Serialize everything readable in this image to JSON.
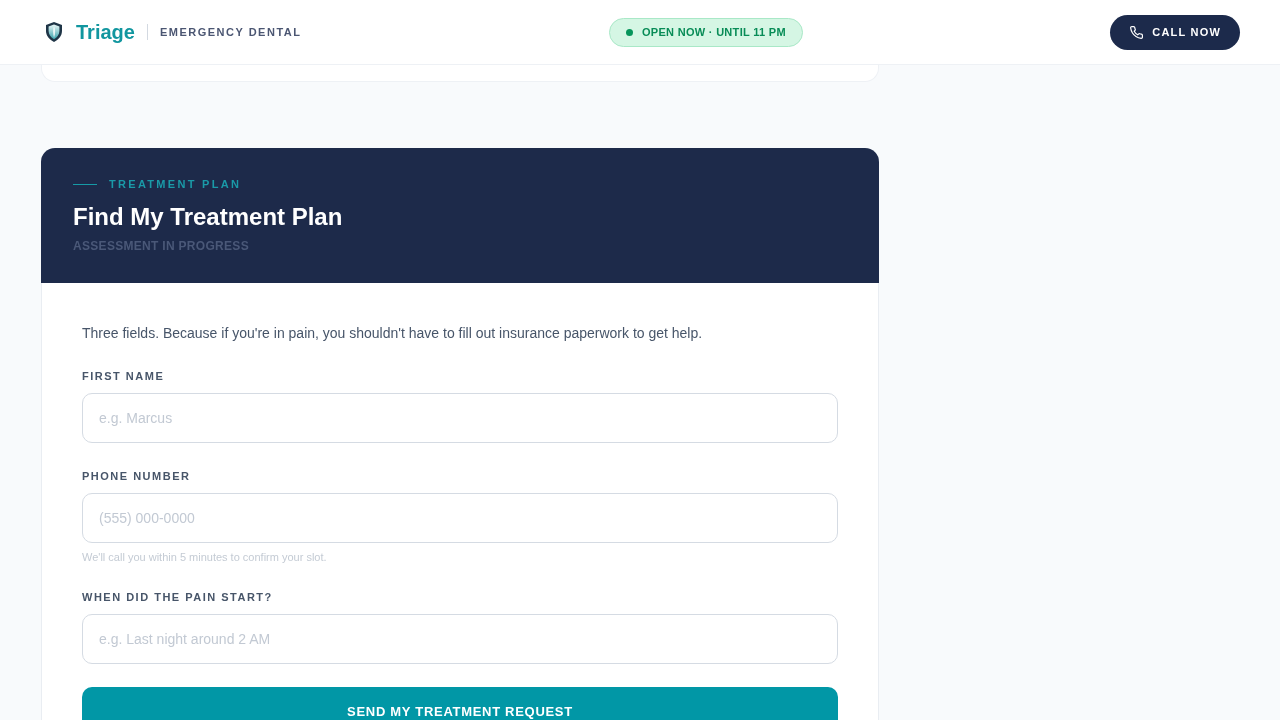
{
  "header": {
    "brand": "Triage",
    "tagline": "EMERGENCY DENTAL",
    "status": {
      "text": "OPEN NOW · UNTIL 11 PM",
      "open": true
    },
    "call_button": "CALL NOW"
  },
  "form_card": {
    "eyebrow": "TREATMENT PLAN",
    "title": "Find My Treatment Plan",
    "status": "ASSESSMENT IN PROGRESS",
    "intro": "Three fields. Because if you're in pain, you shouldn't have to fill out insurance paperwork to get help.",
    "fields": [
      {
        "label": "FIRST NAME",
        "placeholder": "e.g. Marcus"
      },
      {
        "label": "PHONE NUMBER",
        "placeholder": "(555) 000-0000",
        "hint": "We'll call you within 5 minutes to confirm your slot."
      },
      {
        "label": "WHEN DID THE PAIN START?",
        "placeholder": "e.g. Last night around 2 AM"
      }
    ],
    "submit": "SEND MY TREATMENT REQUEST"
  }
}
